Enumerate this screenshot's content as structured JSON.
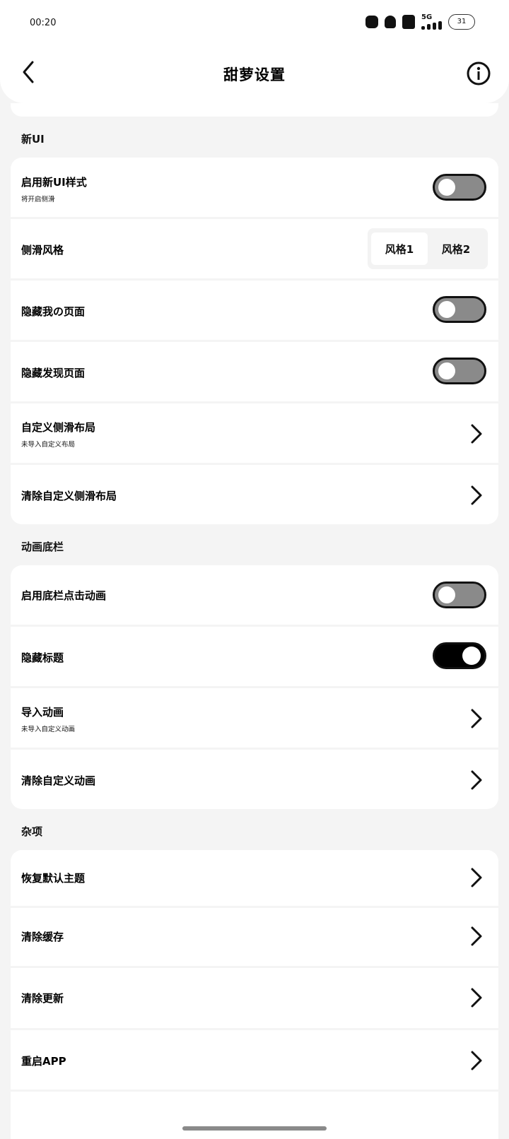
{
  "status_bar": {
    "time": "00:20",
    "network": "5G",
    "battery": "31",
    "icons": [
      "cat-app-icon",
      "notification-bell-icon",
      "hd-icon",
      "signal-icon",
      "battery-icon"
    ]
  },
  "header": {
    "title": "甜萝设置",
    "back_icon": "chevron-left-icon",
    "info_icon": "info-circle-icon"
  },
  "sections": {
    "new_ui": {
      "label": "新UI",
      "items": {
        "enable_new_ui": {
          "title": "启用新UI样式",
          "subtitle": "将开启侧滑",
          "toggle": false
        },
        "drawer_style": {
          "title": "侧滑风格",
          "options": [
            "风格1",
            "风格2"
          ],
          "selected": "风格1"
        },
        "hide_my_page": {
          "title": "隐藏我の页面",
          "toggle": false
        },
        "hide_discover_page": {
          "title": "隐藏发现页面",
          "toggle": false
        },
        "custom_drawer_layout": {
          "title": "自定义侧滑布局",
          "subtitle": "未导入自定义布局"
        },
        "clear_custom_drawer_layout": {
          "title": "清除自定义侧滑布局"
        }
      }
    },
    "animated_bottom_bar": {
      "label": "动画底栏",
      "items": {
        "enable_click_animation": {
          "title": "启用底栏点击动画",
          "toggle": false
        },
        "hide_title": {
          "title": "隐藏标题",
          "toggle": true
        },
        "import_animation": {
          "title": "导入动画",
          "subtitle": "未导入自定义动画"
        },
        "clear_custom_animation": {
          "title": "清除自定义动画"
        }
      }
    },
    "misc": {
      "label": "杂项",
      "items": {
        "restore_default_theme": {
          "title": "恢复默认主题"
        },
        "clear_cache": {
          "title": "清除缓存"
        },
        "clear_update": {
          "title": "清除更新"
        },
        "restart_app": {
          "title": "重启APP"
        }
      }
    }
  },
  "colors": {
    "page_background": "#f4f4f4",
    "card_background": "#ffffff",
    "toggle_off": "#8a8a8a",
    "toggle_on": "#000000"
  }
}
